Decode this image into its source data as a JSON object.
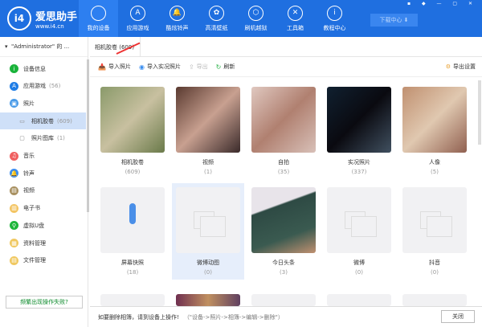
{
  "app": {
    "name": "爱思助手",
    "url": "www.i4.cn",
    "download": "下载中心"
  },
  "nav": [
    {
      "label": "我的设备",
      "icon": ""
    },
    {
      "label": "应用游戏",
      "icon": "A"
    },
    {
      "label": "酷炫铃声",
      "icon": "🔔"
    },
    {
      "label": "高清壁纸",
      "icon": "✿"
    },
    {
      "label": "刷机越狱",
      "icon": "⬡"
    },
    {
      "label": "工具箱",
      "icon": "✕"
    },
    {
      "label": "教程中心",
      "icon": "i"
    }
  ],
  "device": "\"Administrator\" 的 ...",
  "sidebar": [
    {
      "label": "设备信息",
      "count": "",
      "color": "#19b33a",
      "icon": "i"
    },
    {
      "label": "应用游戏",
      "count": "(56)",
      "color": "#1f7de6",
      "icon": "A"
    },
    {
      "label": "照片",
      "count": "",
      "color": "#4a9be8",
      "icon": "▣"
    },
    {
      "label": "相机胶卷",
      "count": "(609)",
      "color": "",
      "icon": "▭"
    },
    {
      "label": "照片图库",
      "count": "(1)",
      "color": "",
      "icon": "▢"
    },
    {
      "label": "音乐",
      "count": "",
      "color": "#f06060",
      "icon": "♫"
    },
    {
      "label": "铃声",
      "count": "",
      "color": "#3d8ef0",
      "icon": "🔔"
    },
    {
      "label": "视频",
      "count": "",
      "color": "#a89060",
      "icon": "▤"
    },
    {
      "label": "电子书",
      "count": "",
      "color": "#f3c462",
      "icon": "▥"
    },
    {
      "label": "虚拟U盘",
      "count": "",
      "color": "#1eb53a",
      "icon": "⚲"
    },
    {
      "label": "资料管理",
      "count": "",
      "color": "#f0c860",
      "icon": "▦"
    },
    {
      "label": "文件管理",
      "count": "",
      "color": "#f0c860",
      "icon": "▤"
    }
  ],
  "fail_link": "频繁出现操作失败?",
  "tab": "相机胶卷 (609)",
  "toolbar": {
    "import": "导入照片",
    "import_live": "导入实况照片",
    "export": "导出",
    "refresh": "刷新",
    "export_settings": "导出设置"
  },
  "albums": [
    {
      "name": "相机胶卷",
      "count": "(609)",
      "thumb": "linear-gradient(135deg,#8a9a6a,#c8c0a0,#6a7a4a)"
    },
    {
      "name": "视频",
      "count": "(1)",
      "thumb": "linear-gradient(135deg,#5a3a30,#c8a090,#3a2a2a)"
    },
    {
      "name": "自拍",
      "count": "(35)",
      "thumb": "linear-gradient(135deg,#e0c8c0,#b08070,#d8c0b8)"
    },
    {
      "name": "实况照片",
      "count": "(337)",
      "thumb": "linear-gradient(135deg,#102030,#0a0a10,#405060)"
    },
    {
      "name": "人像",
      "count": "(5)",
      "thumb": "linear-gradient(135deg,#c09070,#e0c8b0,#906050)"
    },
    {
      "name": "屏幕快照",
      "count": "(18)",
      "thumb": "screen"
    },
    {
      "name": "微博动图",
      "count": "(0)",
      "thumb": "ph"
    },
    {
      "name": "今日头条",
      "count": "(3)",
      "thumb": "linear-gradient(160deg,#e8e4ea 30%,#2e4a44 32%,#3a5a50 70%,#c09070)"
    },
    {
      "name": "微博",
      "count": "(0)",
      "thumb": "ph"
    },
    {
      "name": "抖音",
      "count": "(0)",
      "thumb": "ph"
    }
  ],
  "bottom": {
    "msg": "如要删除相簿，请到设备上操作!",
    "hint": "（\"设备->照片->相簿->编辑->删除\"）",
    "close": "关闭"
  }
}
